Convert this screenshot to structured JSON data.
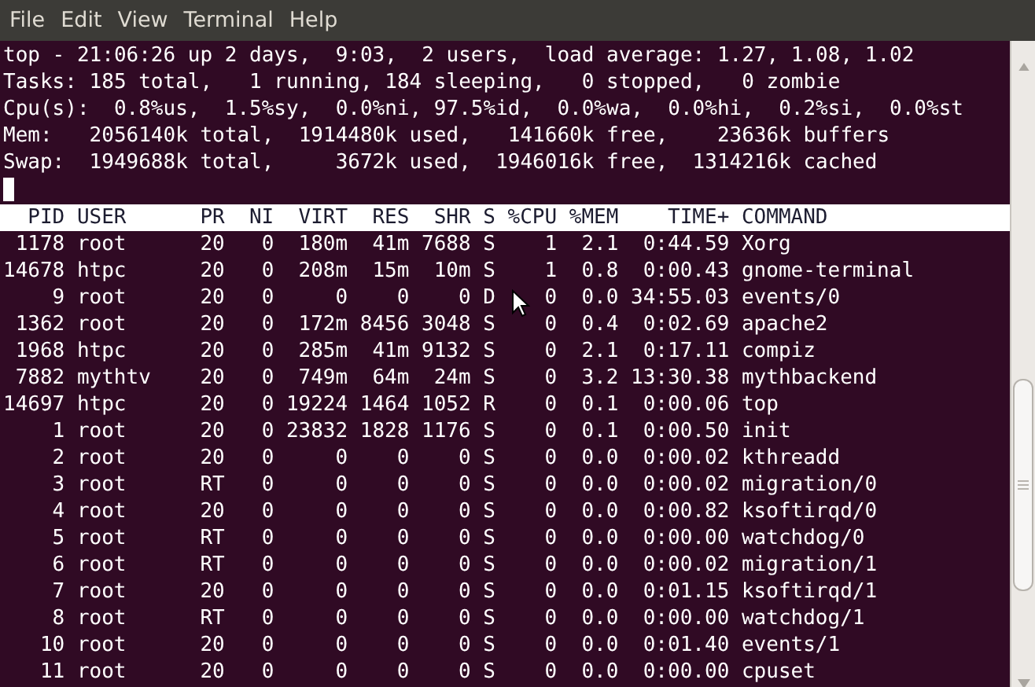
{
  "menu": [
    "File",
    "Edit",
    "View",
    "Terminal",
    "Help"
  ],
  "summary_lines": [
    "top - 21:06:26 up 2 days,  9:03,  2 users,  load average: 1.27, 1.08, 1.02",
    "Tasks: 185 total,   1 running, 184 sleeping,   0 stopped,   0 zombie",
    "Cpu(s):  0.8%us,  1.5%sy,  0.0%ni, 97.5%id,  0.0%wa,  0.0%hi,  0.2%si,  0.0%st",
    "Mem:   2056140k total,  1914480k used,   141660k free,    23636k buffers",
    "Swap:  1949688k total,     3672k used,  1946016k free,  1314216k cached"
  ],
  "table": {
    "columns": [
      "PID",
      "USER",
      "PR",
      "NI",
      "VIRT",
      "RES",
      "SHR",
      "S",
      "%CPU",
      "%MEM",
      "TIME+",
      "COMMAND"
    ],
    "rows": [
      [
        "1178",
        "root",
        "20",
        "0",
        "180m",
        "41m",
        "7688",
        "S",
        "1",
        "2.1",
        "0:44.59",
        "Xorg"
      ],
      [
        "14678",
        "htpc",
        "20",
        "0",
        "208m",
        "15m",
        "10m",
        "S",
        "1",
        "0.8",
        "0:00.43",
        "gnome-terminal"
      ],
      [
        "9",
        "root",
        "20",
        "0",
        "0",
        "0",
        "0",
        "D",
        "0",
        "0.0",
        "34:55.03",
        "events/0"
      ],
      [
        "1362",
        "root",
        "20",
        "0",
        "172m",
        "8456",
        "3048",
        "S",
        "0",
        "0.4",
        "0:02.69",
        "apache2"
      ],
      [
        "1968",
        "htpc",
        "20",
        "0",
        "285m",
        "41m",
        "9132",
        "S",
        "0",
        "2.1",
        "0:17.11",
        "compiz"
      ],
      [
        "7882",
        "mythtv",
        "20",
        "0",
        "749m",
        "64m",
        "24m",
        "S",
        "0",
        "3.2",
        "13:30.38",
        "mythbackend"
      ],
      [
        "14697",
        "htpc",
        "20",
        "0",
        "19224",
        "1464",
        "1052",
        "R",
        "0",
        "0.1",
        "0:00.06",
        "top"
      ],
      [
        "1",
        "root",
        "20",
        "0",
        "23832",
        "1828",
        "1176",
        "S",
        "0",
        "0.1",
        "0:00.50",
        "init"
      ],
      [
        "2",
        "root",
        "20",
        "0",
        "0",
        "0",
        "0",
        "S",
        "0",
        "0.0",
        "0:00.02",
        "kthreadd"
      ],
      [
        "3",
        "root",
        "RT",
        "0",
        "0",
        "0",
        "0",
        "S",
        "0",
        "0.0",
        "0:00.02",
        "migration/0"
      ],
      [
        "4",
        "root",
        "20",
        "0",
        "0",
        "0",
        "0",
        "S",
        "0",
        "0.0",
        "0:00.82",
        "ksoftirqd/0"
      ],
      [
        "5",
        "root",
        "RT",
        "0",
        "0",
        "0",
        "0",
        "S",
        "0",
        "0.0",
        "0:00.00",
        "watchdog/0"
      ],
      [
        "6",
        "root",
        "RT",
        "0",
        "0",
        "0",
        "0",
        "S",
        "0",
        "0.0",
        "0:00.02",
        "migration/1"
      ],
      [
        "7",
        "root",
        "20",
        "0",
        "0",
        "0",
        "0",
        "S",
        "0",
        "0.0",
        "0:01.15",
        "ksoftirqd/1"
      ],
      [
        "8",
        "root",
        "RT",
        "0",
        "0",
        "0",
        "0",
        "S",
        "0",
        "0.0",
        "0:00.00",
        "watchdog/1"
      ],
      [
        "10",
        "root",
        "20",
        "0",
        "0",
        "0",
        "0",
        "S",
        "0",
        "0.0",
        "0:01.40",
        "events/1"
      ],
      [
        "11",
        "root",
        "20",
        "0",
        "0",
        "0",
        "0",
        "S",
        "0",
        "0.0",
        "0:00.00",
        "cpuset"
      ]
    ]
  }
}
